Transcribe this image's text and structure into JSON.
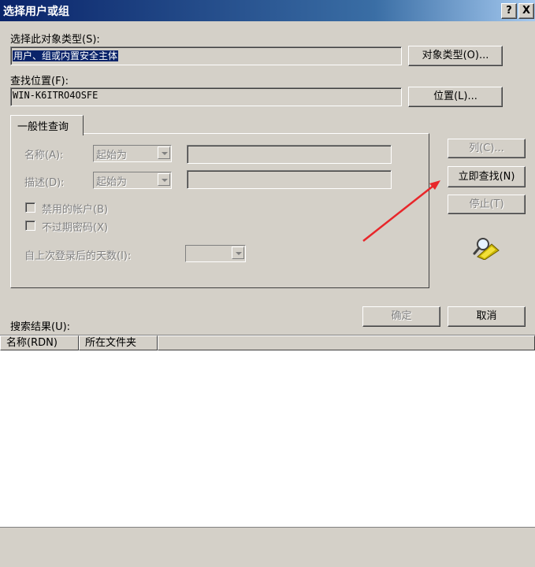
{
  "window": {
    "title": "选择用户或组",
    "help_label": "?",
    "close_label": "X"
  },
  "object_type": {
    "label": "选择此对象类型(S):",
    "value": "用户、组或内置安全主体",
    "button_label": "对象类型(O)..."
  },
  "location": {
    "label": "查找位置(F):",
    "value": "WIN-K6ITRO4OSFE",
    "button_label": "位置(L)..."
  },
  "general_query": {
    "tab_label": "一般性查询",
    "name": {
      "label": "名称(A):",
      "operator": "起始为",
      "value": ""
    },
    "description": {
      "label": "描述(D):",
      "operator": "起始为",
      "value": ""
    },
    "disabled_accounts": {
      "label": "禁用的帐户(B)",
      "checked": false
    },
    "non_expiring_password": {
      "label": "不过期密码(X)",
      "checked": false
    },
    "days_since_logon": {
      "label": "自上次登录后的天数(I):",
      "value": ""
    }
  },
  "side_buttons": {
    "columns": "列(C)...",
    "find_now": "立即查找(N)",
    "stop": "停止(T)"
  },
  "search_icon": "magnifier-search-icon",
  "results": {
    "label": "搜索结果(U):",
    "columns": [
      "名称(RDN)",
      "所在文件夹"
    ],
    "rows": []
  },
  "footer_buttons": {
    "ok": "确定",
    "cancel": "取消"
  },
  "annotation": {
    "color": "#e8262a",
    "points_to": "find_now"
  }
}
